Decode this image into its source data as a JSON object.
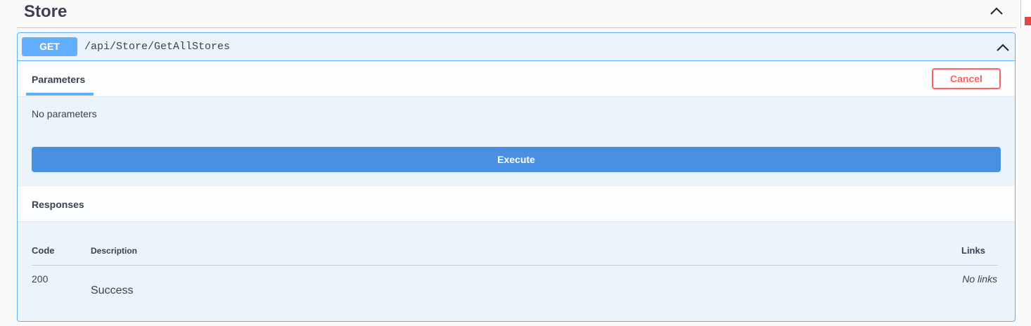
{
  "tag": {
    "title": "Store",
    "toggle_icon": "chevron-up-icon"
  },
  "operation": {
    "method": "GET",
    "path": "/api/Store/GetAllStores",
    "toggle_icon": "chevron-up-icon",
    "colors": {
      "method": "#61affe",
      "execute": "#4990e2",
      "cancel": "#ff6060"
    }
  },
  "parameters": {
    "tab_label": "Parameters",
    "cancel_label": "Cancel",
    "empty_text": "No parameters",
    "execute_label": "Execute"
  },
  "responses": {
    "title": "Responses",
    "columns": {
      "code": "Code",
      "description": "Description",
      "links": "Links"
    },
    "rows": [
      {
        "code": "200",
        "description": "Success",
        "links": "No links"
      }
    ]
  }
}
